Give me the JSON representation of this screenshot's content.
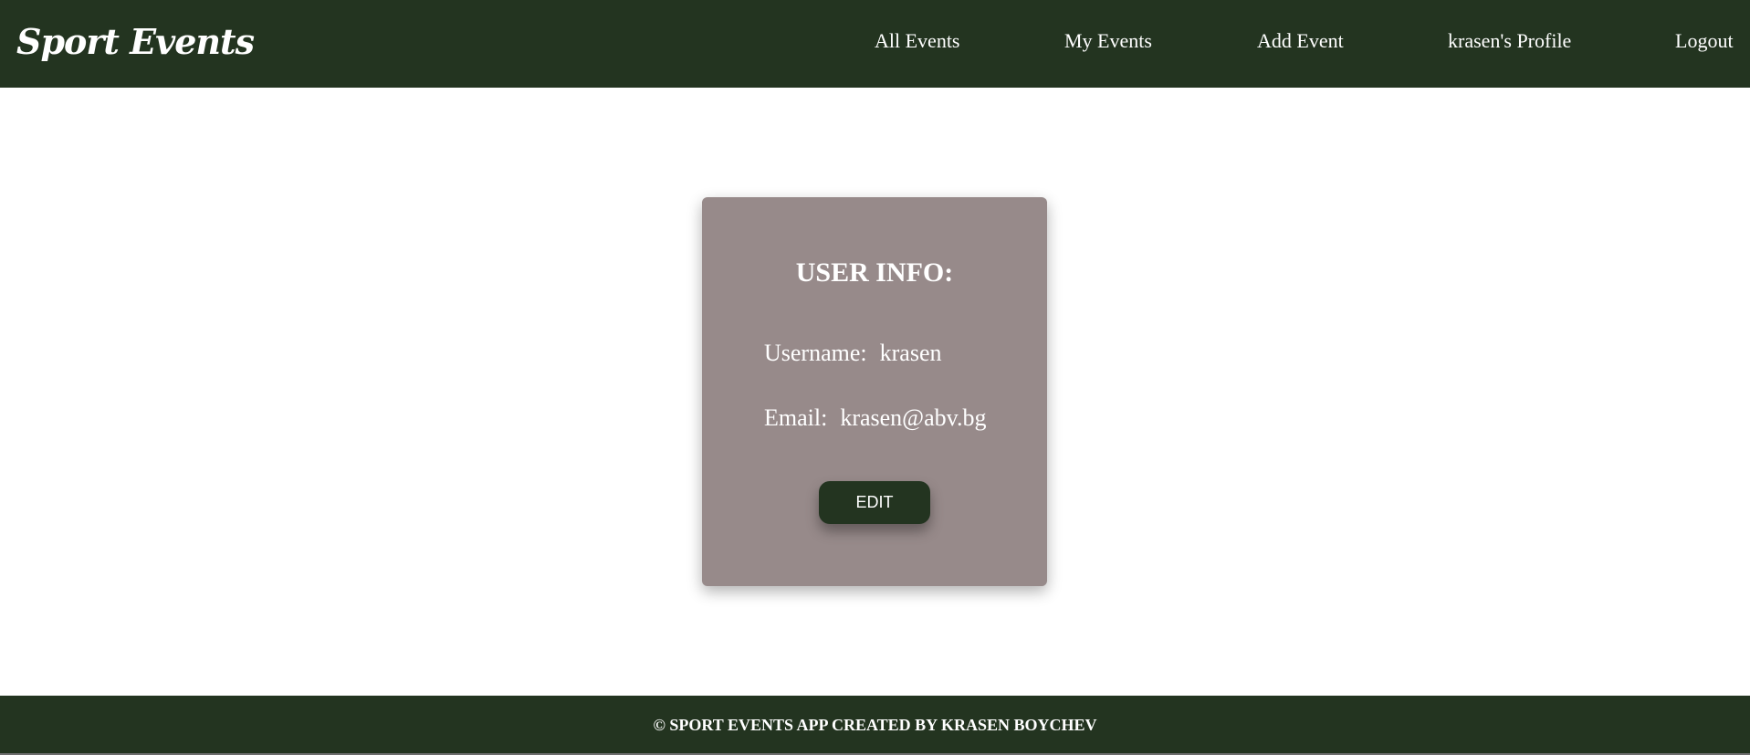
{
  "header": {
    "logo": "Sport Events",
    "nav": {
      "all_events": "All Events",
      "my_events": "My Events",
      "add_event": "Add Event",
      "profile": "krasen's Profile",
      "logout": "Logout"
    }
  },
  "card": {
    "title": "USER INFO:",
    "username_label": "Username:",
    "username_value": "krasen",
    "email_label": "Email:",
    "email_value": "krasen@abv.bg",
    "edit_label": "EDIT"
  },
  "footer": {
    "text": "© SPORT EVENTS APP CREATED BY KRASEN BOYCHEV"
  },
  "colors": {
    "header_bg": "#233420",
    "card_bg": "#978a8a",
    "button_bg": "#233420",
    "text": "#ffffff"
  }
}
